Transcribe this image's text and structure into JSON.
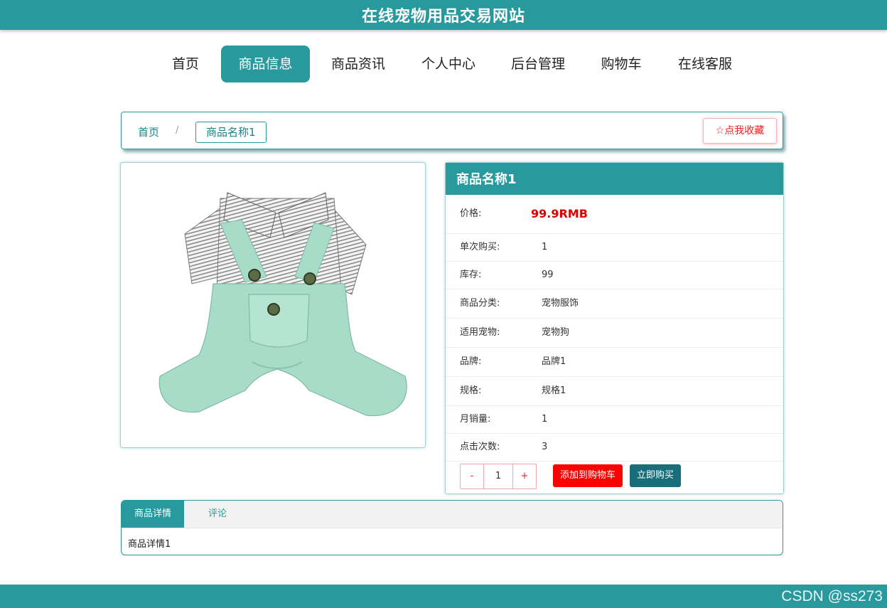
{
  "site": {
    "title": "在线宠物用品交易网站"
  },
  "nav": {
    "items": [
      "首页",
      "商品信息",
      "商品资讯",
      "个人中心",
      "后台管理",
      "购物车",
      "在线客服"
    ],
    "active_index": 1
  },
  "breadcrumb": {
    "home": "首页",
    "separator": "/",
    "current": "商品名称1"
  },
  "favorite": {
    "icon": "star-outline-icon",
    "label": "☆点我收藏"
  },
  "product": {
    "name": "商品名称1",
    "image_alt": "pet overalls",
    "price_label": "价格:",
    "price": "99.9RMB",
    "rows": [
      {
        "key": "单次购买:",
        "value": "1"
      },
      {
        "key": "库存:",
        "value": "99"
      },
      {
        "key": "商品分类:",
        "value": "宠物服饰"
      },
      {
        "key": "适用宠物:",
        "value": "宠物狗"
      },
      {
        "key": "品牌:",
        "value": "品牌1"
      },
      {
        "key": "规格:",
        "value": "规格1"
      },
      {
        "key": "月销量:",
        "value": "1"
      },
      {
        "key": "点击次数:",
        "value": "3"
      }
    ]
  },
  "purchase": {
    "minus": "-",
    "quantity": "1",
    "plus": "+",
    "add_to_cart": "添加到购物车",
    "buy_now": "立即购买"
  },
  "tabs": {
    "items": [
      "商品详情",
      "评论"
    ],
    "active_index": 0,
    "content": "商品详情1"
  },
  "watermark": "CSDN @ss273",
  "colors": {
    "primary": "#289a9e",
    "price": "#e10000",
    "cart_button": "#ff0000",
    "buy_button": "#176e7a"
  }
}
